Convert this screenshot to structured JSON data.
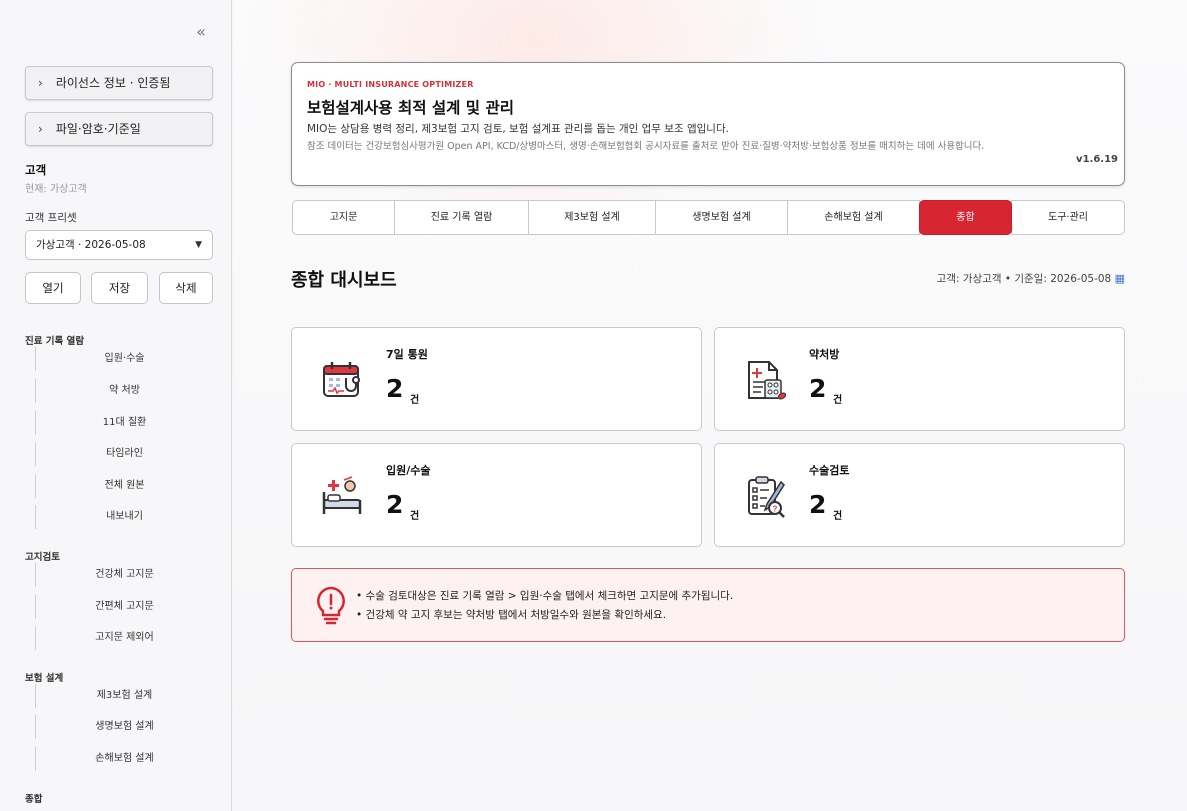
{
  "sidebar": {
    "collapse_glyph": "«",
    "expanders": [
      {
        "label": "라이선스 정보 · 인증됨"
      },
      {
        "label": "파일·암호·기준일"
      }
    ],
    "customer_heading": "고객",
    "customer_current": "현재: 가상고객",
    "preset_label": "고객 프리셋",
    "preset_value": "가상고객 · 2026-05-08",
    "buttons": {
      "open": "열기",
      "save": "저장",
      "delete": "삭제"
    },
    "sections": [
      {
        "title": "진료 기록 열람",
        "items": [
          "입원·수술",
          "약 처방",
          "11대 질환",
          "타임라인",
          "전체 원본",
          "내보내기"
        ]
      },
      {
        "title": "고지검토",
        "items": [
          "건강체 고지문",
          "간편체 고지문",
          "고지문 제외어"
        ]
      },
      {
        "title": "보험 설계",
        "items": [
          "제3보험 설계",
          "생명보험 설계",
          "손해보험 설계"
        ]
      },
      {
        "title": "종합",
        "items": []
      }
    ]
  },
  "hero": {
    "kicker": "MIO · MULTI INSURANCE OPTIMIZER",
    "title": "보험설계사용 최적 설계 및 관리",
    "description": "MIO는 상담용 병력 정리, 제3보험 고지 검토, 보험 설계표 관리를 돕는 개인 업무 보조 앱입니다.",
    "note": "참조 데이터는 건강보험심사평가원 Open API, KCD/상병마스터, 생명·손해보험협회 공시자료를 출처로 받아 진료·질병·약처방·보험상품 정보를 매치하는 데에 사용합니다.",
    "version": "v1.6.19"
  },
  "tabs": [
    {
      "label": "고지문",
      "active": false
    },
    {
      "label": "진료 기록 열람",
      "active": false
    },
    {
      "label": "제3보험 설계",
      "active": false
    },
    {
      "label": "생명보험 설계",
      "active": false
    },
    {
      "label": "손해보험 설계",
      "active": false
    },
    {
      "label": "종합",
      "active": true
    },
    {
      "label": "도구·관리",
      "active": false
    }
  ],
  "dashboard": {
    "title": "종합 대시보드",
    "meta": "고객: 가상고객 • 기준일: 2026-05-08",
    "cards": [
      {
        "label": "7일 통원",
        "value": "2",
        "unit": "건",
        "icon": "calendar-stethoscope-icon"
      },
      {
        "label": "약처방",
        "value": "2",
        "unit": "건",
        "icon": "prescription-icon"
      },
      {
        "label": "입원/수술",
        "value": "2",
        "unit": "건",
        "icon": "hospital-bed-icon"
      },
      {
        "label": "수술검토",
        "value": "2",
        "unit": "건",
        "icon": "clipboard-review-icon"
      }
    ]
  },
  "notice": {
    "lines": [
      "• 수술 검토대상은 진료 기록 열람 > 입원·수술 탭에서 체크하면 고지문에 추가됩니다.",
      "• 건강체 약 고지 후보는 약처방 탭에서 처방일수와 원본을 확인하세요."
    ]
  },
  "colors": {
    "accent": "#d72631",
    "notice_bg": "#fdf1f1",
    "notice_border": "#e0555c"
  }
}
